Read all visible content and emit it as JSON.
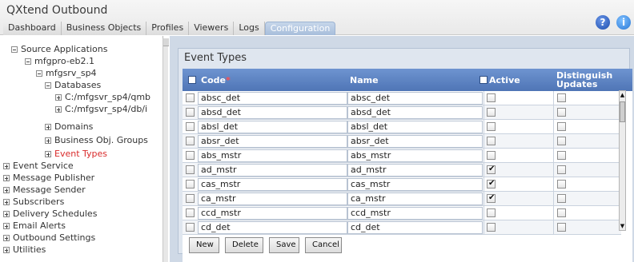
{
  "header": {
    "title": "QXtend Outbound",
    "tabs": [
      {
        "label": "Dashboard"
      },
      {
        "label": "Business Objects"
      },
      {
        "label": "Profiles"
      },
      {
        "label": "Viewers"
      },
      {
        "label": "Logs"
      },
      {
        "label": "Configuration"
      }
    ]
  },
  "icons": {
    "help": "help-icon",
    "info": "info-icon",
    "help_glyph": "?",
    "info_glyph": "i"
  },
  "tree": {
    "items": [
      {
        "label": "Source Applications",
        "state": "collapse"
      },
      {
        "label": "mfgpro-eb2.1",
        "state": "collapse"
      },
      {
        "label": "mfgsrv_sp4",
        "state": "collapse"
      },
      {
        "label": "Databases",
        "state": "collapse"
      },
      {
        "label": "C:/mfgsvr_sp4/qmb",
        "state": "leaf"
      },
      {
        "label": "C:/mfgsvr_sp4/db/i",
        "state": "leaf"
      },
      {
        "label": "Domains",
        "state": "leaf"
      },
      {
        "label": "Business Obj. Groups",
        "state": "leaf"
      },
      {
        "label": "Event Types",
        "state": "leaf",
        "active": true
      },
      {
        "label": "Event Service",
        "state": "expand"
      },
      {
        "label": "Message Publisher",
        "state": "expand"
      },
      {
        "label": "Message Sender",
        "state": "expand"
      },
      {
        "label": "Subscribers",
        "state": "expand"
      },
      {
        "label": "Delivery Schedules",
        "state": "expand"
      },
      {
        "label": "Email Alerts",
        "state": "expand"
      },
      {
        "label": "Outbound Settings",
        "state": "expand"
      },
      {
        "label": "Utilities",
        "state": "expand"
      }
    ]
  },
  "panel": {
    "title": "Event Types",
    "columns": {
      "code": "Code",
      "required_mark": "*",
      "name": "Name",
      "active": "Active",
      "distinguish_line1": "Distinguish",
      "distinguish_line2": "Updates"
    },
    "rows": [
      {
        "code": "absc_det",
        "name": "absc_det",
        "active": false,
        "distinguish": false
      },
      {
        "code": "absd_det",
        "name": "absd_det",
        "active": false,
        "distinguish": false
      },
      {
        "code": "absl_det",
        "name": "absl_det",
        "active": false,
        "distinguish": false
      },
      {
        "code": "absr_det",
        "name": "absr_det",
        "active": false,
        "distinguish": false
      },
      {
        "code": "abs_mstr",
        "name": "abs_mstr",
        "active": false,
        "distinguish": false
      },
      {
        "code": "ad_mstr",
        "name": "ad_mstr",
        "active": true,
        "distinguish": false
      },
      {
        "code": "cas_mstr",
        "name": "cas_mstr",
        "active": true,
        "distinguish": false
      },
      {
        "code": "ca_mstr",
        "name": "ca_mstr",
        "active": true,
        "distinguish": false
      },
      {
        "code": "ccd_mstr",
        "name": "ccd_mstr",
        "active": false,
        "distinguish": false
      },
      {
        "code": "cd_det",
        "name": "cd_det",
        "active": false,
        "distinguish": false
      }
    ]
  },
  "buttons": {
    "new": "New",
    "delete": "Delete",
    "save": "Save",
    "cancel": "Cancel"
  },
  "scroll": {
    "up_glyph": "▲",
    "down_glyph": "▼"
  }
}
